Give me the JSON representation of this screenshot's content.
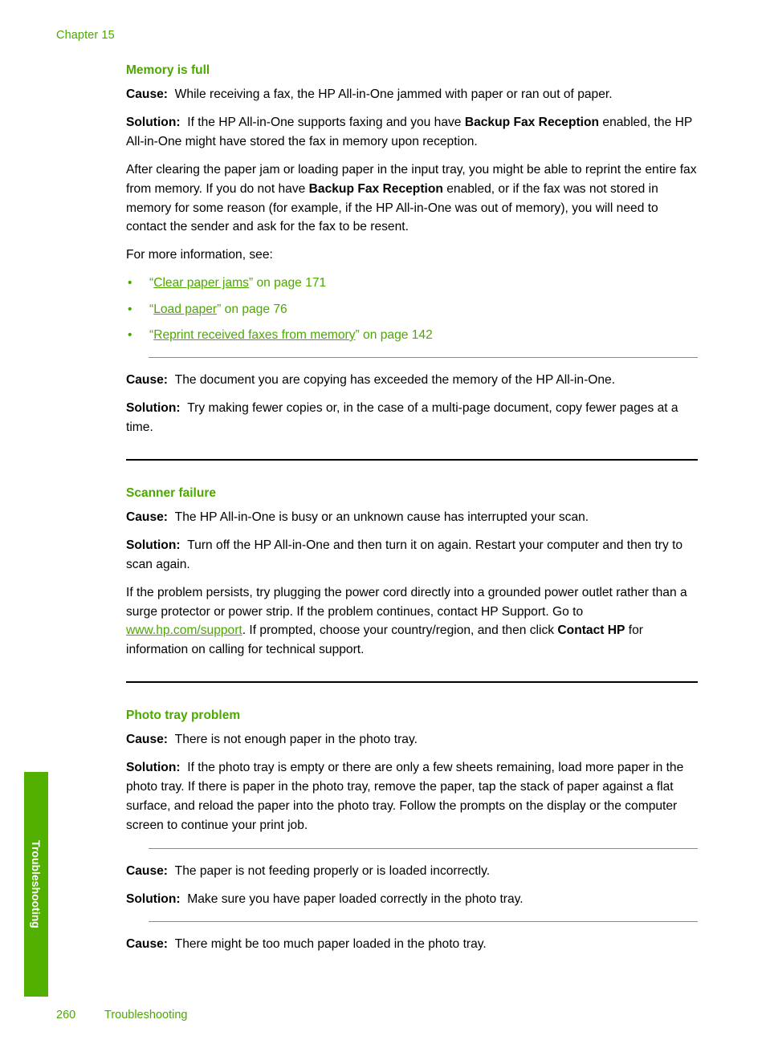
{
  "header": {
    "chapter": "Chapter 15"
  },
  "side_tab": {
    "label": "Troubleshooting",
    "color": "#52B000"
  },
  "footer": {
    "page_number": "260",
    "section": "Troubleshooting"
  },
  "colors": {
    "heading_green": "#4CA800",
    "tab_green": "#52B000",
    "link_green": "#4CA800",
    "body_text": "#000000",
    "thin_rule": "#8b8b8b",
    "thick_rule": "#000000"
  },
  "labels": {
    "cause": "Cause:",
    "solution": "Solution:",
    "bullet": "•"
  },
  "sections": [
    {
      "heading": "Memory is full",
      "blocks": [
        {
          "cause_text": "While receiving a fax, the HP All-in-One jammed with paper or ran out of paper.",
          "solution_pre": "If the HP All-in-One supports faxing and you have ",
          "solution_bold": "Backup Fax Reception",
          "solution_post": " enabled, the HP All-in-One might have stored the fax in memory upon reception.",
          "paragraph_pre": "After clearing the paper jam or loading paper in the input tray, you might be able to reprint the entire fax from memory. If you do not have ",
          "paragraph_bold": "Backup Fax Reception",
          "paragraph_post": " enabled, or if the fax was not stored in memory for some reason (for example, if the HP All-in-One was out of memory), you will need to contact the sender and ask for the fax to be resent.",
          "see_also_intro": "For more information, see:",
          "links": [
            {
              "open_quote": "“",
              "title": "Clear paper jams",
              "close_quote": "”",
              "suffix": " on page 171"
            },
            {
              "open_quote": "“",
              "title": "Load paper",
              "close_quote": "”",
              "suffix": " on page 76"
            },
            {
              "open_quote": "“",
              "title": "Reprint received faxes from memory",
              "close_quote": "”",
              "suffix": " on page 142"
            }
          ]
        },
        {
          "cause_text": "The document you are copying has exceeded the memory of the HP All-in-One.",
          "solution_text": "Try making fewer copies or, in the case of a multi-page document, copy fewer pages at a time."
        }
      ]
    },
    {
      "heading": "Scanner failure",
      "blocks": [
        {
          "cause_text": "The HP All-in-One is busy or an unknown cause has interrupted your scan.",
          "solution_text": "Turn off the HP All-in-One and then turn it on again. Restart your computer and then try to scan again.",
          "paragraph_pre": "If the problem persists, try plugging the power cord directly into a grounded power outlet rather than a surge protector or power strip. If the problem continues, contact HP Support. Go to ",
          "url": "www.hp.com/support",
          "paragraph_mid": ". If prompted, choose your country/region, and then click ",
          "paragraph_bold": "Contact HP",
          "paragraph_post": " for information on calling for technical support."
        }
      ]
    },
    {
      "heading": "Photo tray problem",
      "blocks": [
        {
          "cause_text": "There is not enough paper in the photo tray.",
          "solution_text": "If the photo tray is empty or there are only a few sheets remaining, load more paper in the photo tray. If there is paper in the photo tray, remove the paper, tap the stack of paper against a flat surface, and reload the paper into the photo tray. Follow the prompts on the display or the computer screen to continue your print job."
        },
        {
          "cause_text": "The paper is not feeding properly or is loaded incorrectly.",
          "solution_text": "Make sure you have paper loaded correctly in the photo tray."
        },
        {
          "cause_text": "There might be too much paper loaded in the photo tray."
        }
      ]
    }
  ]
}
